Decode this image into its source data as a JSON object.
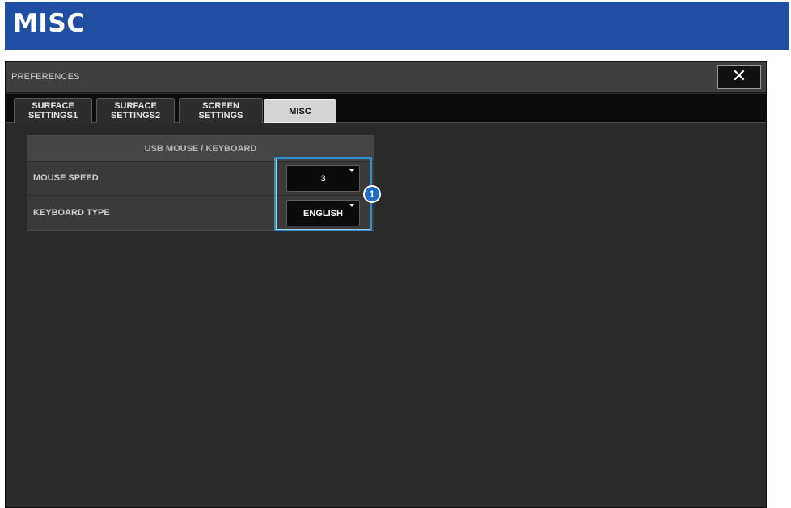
{
  "page": {
    "heading": "MISC"
  },
  "window": {
    "title": "PREFERENCES",
    "close_glyph": "✕",
    "close_icon": "close-icon"
  },
  "tabs": [
    {
      "label": "SURFACE\nSETTINGS1",
      "active": false
    },
    {
      "label": "SURFACE\nSETTINGS2",
      "active": false
    },
    {
      "label": "SCREEN\nSETTINGS",
      "active": false
    },
    {
      "label": "MISC",
      "active": true
    }
  ],
  "panel": {
    "header": "USB MOUSE / KEYBOARD",
    "rows": [
      {
        "label": "MOUSE SPEED",
        "value": "3"
      },
      {
        "label": "KEYBOARD TYPE",
        "value": "ENGLISH"
      }
    ]
  },
  "callout": {
    "number": "1"
  },
  "colors": {
    "heading_bar": "#1f4ea3",
    "window_bg": "#2a2a2a",
    "highlight": "#2b8fd6",
    "callout": "#1d6fc4"
  }
}
